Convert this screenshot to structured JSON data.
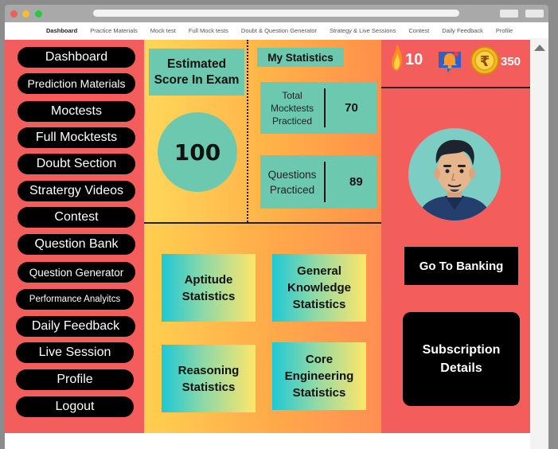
{
  "nav": {
    "items": [
      "Dashboard",
      "Practice Materials",
      "Mock test",
      "Full Mock tests",
      "Doubt & Question Generator",
      "Strategy & Live Sessions",
      "Contest",
      "Daily Feedback",
      "Profile"
    ]
  },
  "sidebar": {
    "items": [
      "Dashboard",
      "Prediction Materials",
      "Moctests",
      "Full Mocktests",
      "Doubt Section",
      "Stratergy Videos",
      "Contest",
      "Question Bank",
      "Question Generator",
      "Performance Analyitcs",
      "Daily Feedback",
      "Live Session",
      "Profile",
      "Logout"
    ]
  },
  "score": {
    "label": "Estimated Score In Exam",
    "value": "100"
  },
  "stats": {
    "title": "My Statistics",
    "mocktests_label": "Total Mocktests Practiced",
    "mocktests_value": "70",
    "questions_label": "Questions Practiced",
    "questions_value": "89"
  },
  "tiles": {
    "aptitude": "Aptitude Statistics",
    "gk": "General Knowledge Statistics",
    "reasoning": "Reasoning Statistics",
    "core": "Core Engineering Statistics"
  },
  "header": {
    "streak": "10",
    "coins": "350",
    "streak_icon": "fire-icon",
    "notification_icon": "bell-icon",
    "coin_icon": "rupee-coin-icon"
  },
  "actions": {
    "banking": "Go To Banking",
    "subscription": "Subscription Details"
  },
  "colors": {
    "sidebar_bg": "#f35d5b",
    "teal": "#6dc8b0",
    "button_bg": "#000000"
  }
}
